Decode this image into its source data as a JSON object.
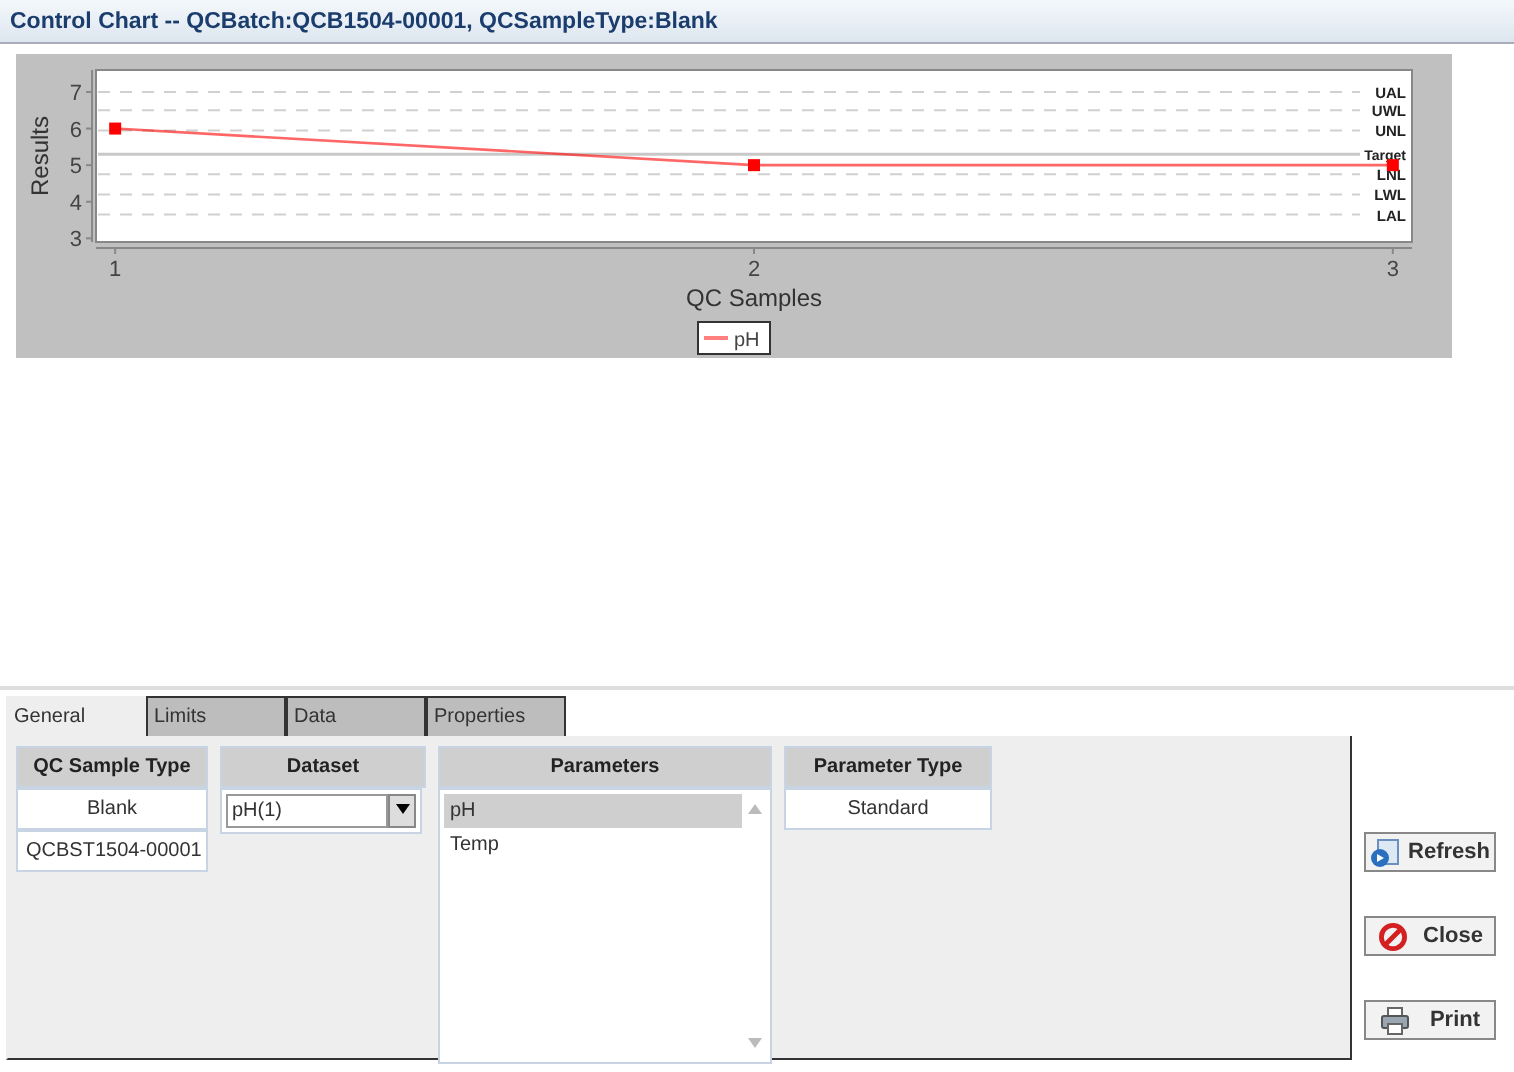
{
  "window": {
    "title": "Control Chart -- QCBatch:QCB1504-00001, QCSampleType:Blank"
  },
  "chart": {
    "chart_data": {
      "type": "line",
      "xlabel": "QC Samples",
      "ylabel": "Results",
      "x": [
        1,
        2,
        3
      ],
      "series": [
        {
          "name": "pH",
          "color": "#ff0000",
          "marker": "s",
          "values": [
            6,
            5,
            5
          ]
        }
      ],
      "xlim": [
        0.97,
        3.03
      ],
      "ylim": [
        2.9,
        7.6
      ],
      "xticks": [
        1,
        2,
        3
      ],
      "yticks": [
        3,
        4,
        5,
        6,
        7
      ],
      "ref_lines": [
        {
          "axis": "y",
          "value": 7.0,
          "label": "UAL"
        },
        {
          "axis": "y",
          "value": 6.5,
          "label": "UWL"
        },
        {
          "axis": "y",
          "value": 5.95,
          "label": "UNL"
        },
        {
          "axis": "y",
          "value": 5.3,
          "label": "Target"
        },
        {
          "axis": "y",
          "value": 4.75,
          "label": "LNL"
        },
        {
          "axis": "y",
          "value": 4.2,
          "label": "LWL"
        },
        {
          "axis": "y",
          "value": 3.65,
          "label": "LAL"
        }
      ]
    }
  },
  "tabs": [
    {
      "label": "General",
      "selected": true
    },
    {
      "label": "Limits",
      "selected": false
    },
    {
      "label": "Data",
      "selected": false
    },
    {
      "label": "Properties",
      "selected": false
    }
  ],
  "qc_sample_type": {
    "header": "QC Sample Type",
    "rows": [
      "Blank",
      "QCBST1504-00001"
    ]
  },
  "dataset": {
    "header": "Dataset",
    "value": "pH(1)"
  },
  "parameters": {
    "header": "Parameters",
    "items": [
      {
        "label": "pH",
        "selected": true
      },
      {
        "label": "Temp",
        "selected": false
      }
    ]
  },
  "parameter_type": {
    "header": "Parameter Type",
    "rows": [
      "Standard"
    ]
  },
  "buttons": [
    {
      "label": "Refresh",
      "kind": "refresh"
    },
    {
      "label": "Close",
      "kind": "close"
    },
    {
      "label": "Print",
      "kind": "print"
    }
  ]
}
